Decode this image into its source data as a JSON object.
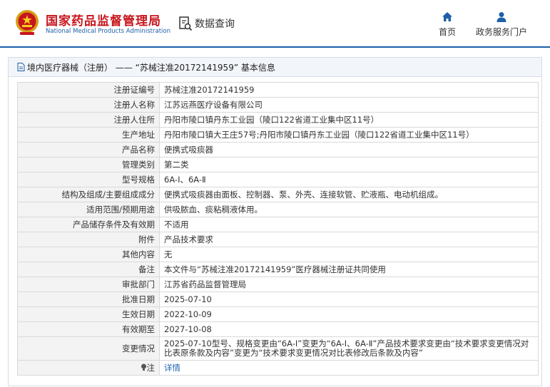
{
  "header": {
    "site_title": "国家药品监督管理局",
    "site_subtitle": "National Medical Products Administration",
    "query_label": "数据查询",
    "nav": [
      {
        "label": "首页",
        "icon": "home-icon"
      },
      {
        "label": "政务服务门户",
        "icon": "user-icon"
      }
    ]
  },
  "panel": {
    "title": "境内医疗器械（注册） —— “苏械注准20172141959” 基本信息"
  },
  "rows": [
    {
      "key": "注册证编号",
      "value": "苏械注准20172141959"
    },
    {
      "key": "注册人名称",
      "value": "江苏远燕医疗设备有限公司"
    },
    {
      "key": "注册人住所",
      "value": "丹阳市陵口镇丹东工业园（陵口122省道工业集中区11号）"
    },
    {
      "key": "生产地址",
      "value": "丹阳市陵口镇大王庄57号;丹阳市陵口镇丹东工业园（陵口122省道工业集中区11号）"
    },
    {
      "key": "产品名称",
      "value": "便携式吸痰器"
    },
    {
      "key": "管理类别",
      "value": "第二类"
    },
    {
      "key": "型号规格",
      "value": "6A-Ⅰ、6A-Ⅱ"
    },
    {
      "key": "结构及组成/主要组成成分",
      "value": "便携式吸痰器由面板、控制器、泵、外壳、连接软管、贮液瓶、电动机组成。"
    },
    {
      "key": "适用范围/预期用途",
      "value": "供吸脓血、痰粘稠液体用。"
    },
    {
      "key": "产品储存条件及有效期",
      "value": "不适用"
    },
    {
      "key": "附件",
      "value": "产品技术要求"
    },
    {
      "key": "其他内容",
      "value": "无"
    },
    {
      "key": "备注",
      "value": "本文件与“苏械注准20172141959”医疗器械注册证共同使用"
    },
    {
      "key": "审批部门",
      "value": "江苏省药品监督管理局"
    },
    {
      "key": "批准日期",
      "value": "2025-07-10"
    },
    {
      "key": "生效日期",
      "value": "2022-10-09"
    },
    {
      "key": "有效期至",
      "value": "2027-10-08"
    },
    {
      "key": "变更情况",
      "value": "2025-07-10型号、规格变更由“6A-Ⅰ”变更为“6A-Ⅰ、6A-Ⅱ”产品技术要求变更由“技术要求变更情况对比表原条款及内容”变更为“技术要求变更情况对比表修改后条款及内容”"
    }
  ],
  "note": {
    "key": "注",
    "link_label": "详情",
    "icon": "lightbulb-icon"
  }
}
